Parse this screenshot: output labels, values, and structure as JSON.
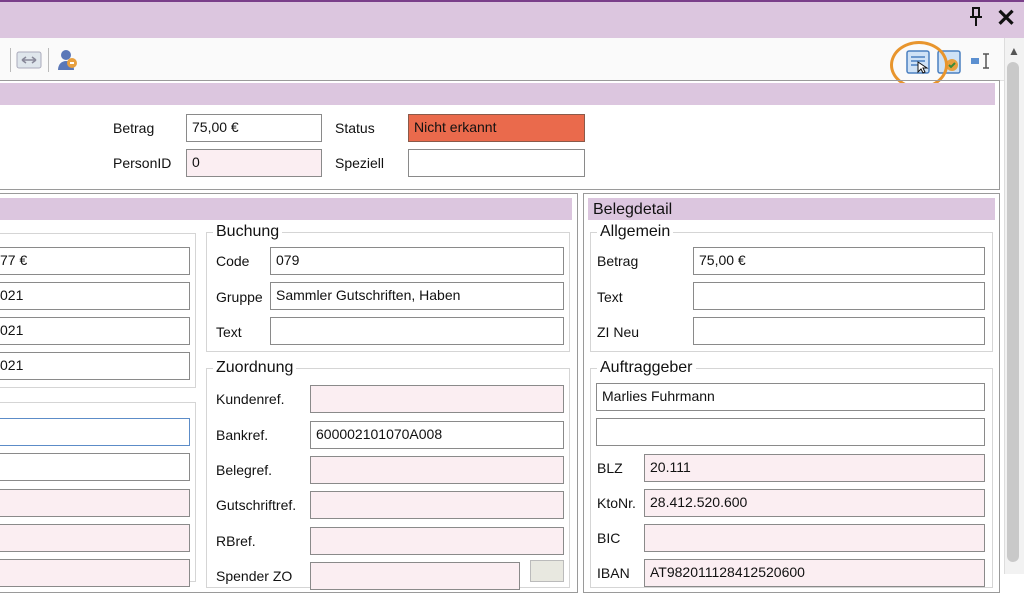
{
  "window": {
    "pin_icon": "pin-icon",
    "close_icon": "close-icon"
  },
  "toolbar": {
    "icons": [
      "document-icon",
      "arrows-icon",
      "users-icon",
      "view-icon",
      "edit-icon",
      "text-cursor-icon"
    ]
  },
  "top_panel": {
    "betrag_label": "Betrag",
    "betrag_value": "75,00 €",
    "status_label": "Status",
    "status_value": "Nicht erkannt",
    "status_color": "#ea6a4c",
    "personid_label": "PersonID",
    "personid_value": "0",
    "speziell_label": "Speziell",
    "speziell_value": ""
  },
  "left_col": {
    "values": [
      "77 €",
      "021",
      "021",
      "021"
    ]
  },
  "buchung": {
    "title": "Buchung",
    "code_label": "Code",
    "code_value": "079",
    "gruppe_label": "Gruppe",
    "gruppe_value": "Sammler Gutschriften, Haben",
    "text_label": "Text",
    "text_value": ""
  },
  "zuordnung": {
    "title": "Zuordnung",
    "kundenref_label": "Kundenref.",
    "kundenref_value": "",
    "bankref_label": "Bankref.",
    "bankref_value": "600002101070A008",
    "belegref_label": "Belegref.",
    "belegref_value": "",
    "gutschriftref_label": "Gutschriftref.",
    "gutschriftref_value": "",
    "rbref_label": "RBref.",
    "rbref_value": "",
    "spender_label": "Spender ZO",
    "spender_value": ""
  },
  "belegdetail": {
    "title": "Belegdetail",
    "allgemein_title": "Allgemein",
    "betrag_label": "Betrag",
    "betrag_value": "75,00 €",
    "text_label": "Text",
    "text_value": "",
    "zlneu_label": "ZI Neu",
    "zlneu_value": "",
    "auftraggeber_title": "Auftraggeber",
    "name_value": "Marlies Fuhrmann",
    "line2_value": "",
    "blz_label": "BLZ",
    "blz_value": "20.111",
    "ktonr_label": "KtoNr.",
    "ktonr_value": "28.412.520.600",
    "bic_label": "BIC",
    "bic_value": "",
    "iban_label": "IBAN",
    "iban_value": "AT982011128412520600"
  }
}
